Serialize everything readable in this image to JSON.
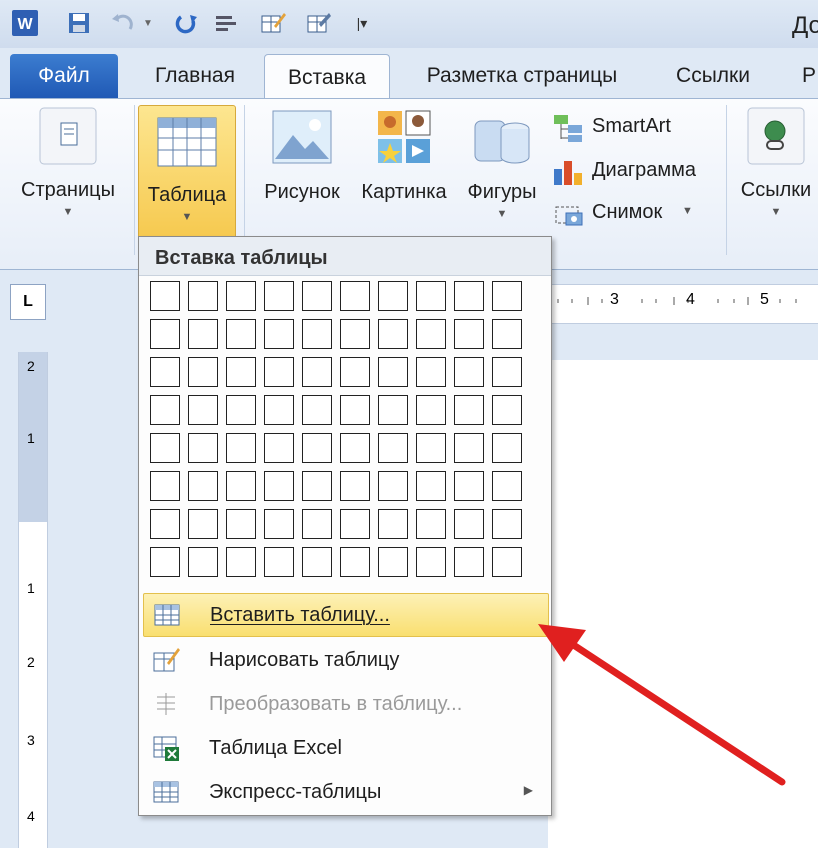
{
  "window": {
    "title_partial": "До"
  },
  "tabs": [
    "Файл",
    "Главная",
    "Вставка",
    "Разметка страницы",
    "Ссылки",
    "Р"
  ],
  "ribbon": {
    "pages": "Страницы",
    "table": "Таблица",
    "picture": "Рисунок",
    "clipart": "Картинка",
    "shapes": "Фигуры",
    "smartart": "SmartArt",
    "chart": "Диаграмма",
    "screenshot": "Снимок",
    "links": "Ссылки"
  },
  "menu": {
    "header": "Вставка таблицы",
    "grid": {
      "columns": 10,
      "rows": 8
    },
    "items": [
      {
        "label": "Вставить таблицу...",
        "icon": "insert-table-icon",
        "state": "highlighted"
      },
      {
        "label": "Нарисовать таблицу",
        "icon": "draw-table-icon",
        "state": "normal"
      },
      {
        "label": "Преобразовать в таблицу...",
        "icon": "convert-table-icon",
        "state": "disabled"
      },
      {
        "label": "Таблица Excel",
        "icon": "excel-table-icon",
        "state": "normal"
      },
      {
        "label": "Экспресс-таблицы",
        "icon": "quick-tables-icon",
        "state": "normal",
        "submenu": true
      }
    ]
  },
  "ruler": {
    "h_numbers": [
      "3",
      "4",
      "5"
    ],
    "v_numbers": [
      "2",
      "1",
      "1",
      "2",
      "3",
      "4"
    ],
    "tab_selector": "L"
  },
  "colors": {
    "accent_file_tab": "#2b62bd",
    "highlight": "#f9df70",
    "arrow": "#e0201f"
  }
}
